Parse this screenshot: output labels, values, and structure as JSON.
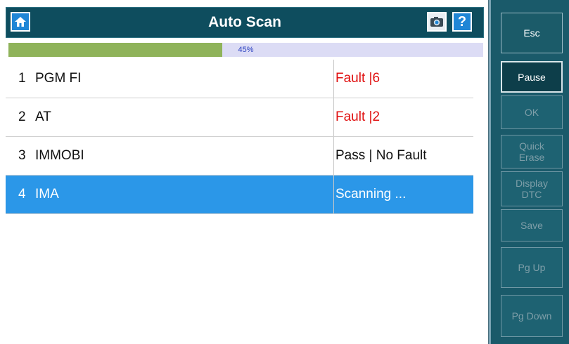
{
  "header": {
    "title": "Auto Scan",
    "icons": [
      "home-icon",
      "camera-icon",
      "help-icon"
    ]
  },
  "progress": {
    "percent": 45,
    "label": "45%"
  },
  "rows": [
    {
      "index": "1",
      "name": "PGM FI",
      "status": "Fault |6",
      "status_color": "#e01010",
      "selected": false
    },
    {
      "index": "2",
      "name": "AT",
      "status": "Fault |2",
      "status_color": "#e01010",
      "selected": false
    },
    {
      "index": "3",
      "name": "IMMOBI",
      "status": "Pass | No Fault",
      "status_color": "#111111",
      "selected": false
    },
    {
      "index": "4",
      "name": "IMA",
      "status": "Scanning ...",
      "status_color": "#ffffff",
      "selected": true
    }
  ],
  "sidebar": {
    "esc": "Esc",
    "pause": "Pause",
    "ok": "OK",
    "quick_erase_1": "Quick",
    "quick_erase_2": "Erase",
    "display_dtc_1": "Display",
    "display_dtc_2": "DTC",
    "save": "Save",
    "pg_up": "Pg Up",
    "pg_down": "Pg Down"
  },
  "colors": {
    "header_bg": "#0e4d5e",
    "progress_fill": "#8fb35a",
    "selected_row": "#2b97e8",
    "fault": "#e01010",
    "sidebar_bg": "#1a5a6a"
  }
}
